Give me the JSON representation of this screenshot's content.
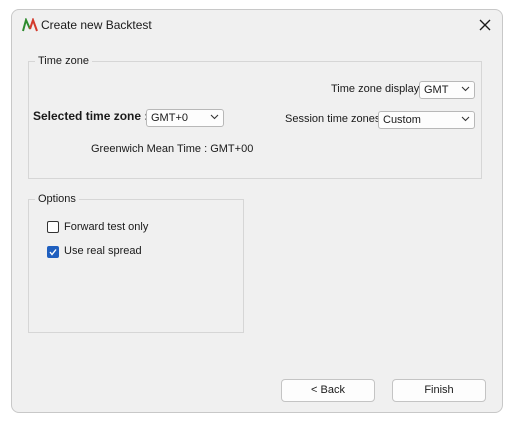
{
  "window": {
    "title": "Create new Backtest",
    "app_icon": "app-logo-icon",
    "close_icon": "close-icon"
  },
  "timezone_group": {
    "title": "Time zone",
    "display_label": "Time zone display :",
    "display_value": "GMT",
    "selected_label": "Selected time zone :",
    "selected_value": "GMT+0",
    "session_label": "Session time zones :",
    "session_value": "Custom",
    "description": "Greenwich Mean Time : GMT+00"
  },
  "options_group": {
    "title": "Options",
    "forward_test_label": "Forward test only",
    "forward_test_checked": false,
    "real_spread_label": "Use real spread",
    "real_spread_checked": true
  },
  "buttons": {
    "back_label": "< Back",
    "finish_label": "Finish"
  },
  "colors": {
    "accent": "#1f5fbf",
    "logo_green": "#2e8b2e",
    "logo_red": "#d33a2c"
  }
}
